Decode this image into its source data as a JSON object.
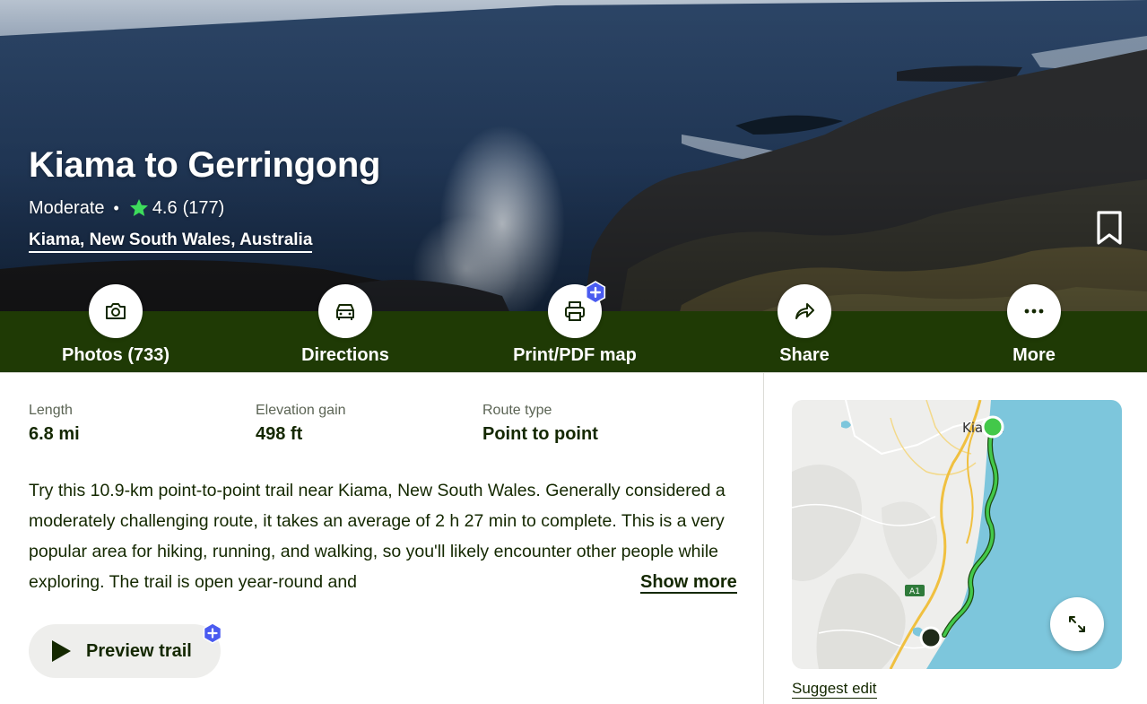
{
  "hero": {
    "title": "Kiama to Gerringong",
    "difficulty": "Moderate",
    "separator": "•",
    "rating": "4.6",
    "review_count": "(177)",
    "location": "Kiama, New South Wales, Australia"
  },
  "actions": [
    {
      "label": "Photos (733)",
      "icon": "camera-icon",
      "premium": false
    },
    {
      "label": "Directions",
      "icon": "car-icon",
      "premium": false
    },
    {
      "label": "Print/PDF map",
      "icon": "printer-icon",
      "premium": true
    },
    {
      "label": "Share",
      "icon": "share-arrow-icon",
      "premium": false
    },
    {
      "label": "More",
      "icon": "more-dots-icon",
      "premium": false
    }
  ],
  "stats": [
    {
      "label": "Length",
      "value": "6.8 mi"
    },
    {
      "label": "Elevation gain",
      "value": "498 ft"
    },
    {
      "label": "Route type",
      "value": "Point to point"
    }
  ],
  "description": "Try this 10.9-km point-to-point trail near Kiama, New South Wales. Generally considered a moderately challenging route, it takes an average of 2 h 27 min to complete. This is a very popular area for hiking, running, and walking, so you'll likely encounter other people while exploring. The trail is open year-round and",
  "show_more_label": "Show more",
  "preview_label": "Preview trail",
  "map": {
    "town_label": "Kiama",
    "road_label": "A1",
    "suggest_edit_label": "Suggest edit"
  },
  "colors": {
    "action_bar": "#1f3a05",
    "star": "#3ddc5c",
    "trail": "#43c84a",
    "text": "#142800",
    "premium_badge": "#4a5bf0",
    "water": "#7dc6dc"
  }
}
